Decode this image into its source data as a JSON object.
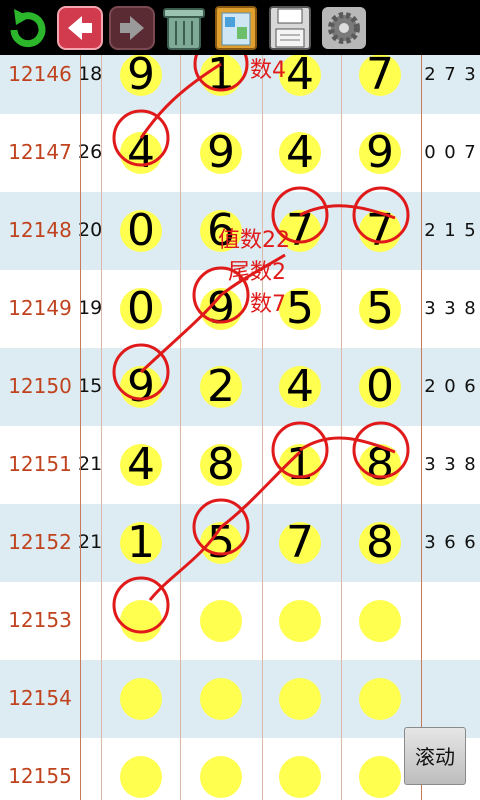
{
  "toolbar": {
    "buttons": [
      {
        "name": "refresh-icon"
      },
      {
        "name": "back-arrow-icon"
      },
      {
        "name": "forward-arrow-icon"
      },
      {
        "name": "trash-icon"
      },
      {
        "name": "clipboard-icon"
      },
      {
        "name": "save-disk-icon"
      },
      {
        "name": "gear-icon"
      }
    ]
  },
  "colors": {
    "digit_circle": "#ffff50",
    "id_text": "#c0431f",
    "annotation_red": "#e01a1a",
    "row_alt": "#dcecf2"
  },
  "rows": [
    {
      "id": "12146",
      "sum": "18",
      "digits": [
        "9",
        "1",
        "4",
        "7"
      ],
      "tail": [
        "2",
        "7",
        "3"
      ]
    },
    {
      "id": "12147",
      "sum": "26",
      "digits": [
        "4",
        "9",
        "4",
        "9"
      ],
      "tail": [
        "0",
        "0",
        "7"
      ]
    },
    {
      "id": "12148",
      "sum": "20",
      "digits": [
        "0",
        "6",
        "7",
        "7"
      ],
      "tail": [
        "2",
        "1",
        "5"
      ]
    },
    {
      "id": "12149",
      "sum": "19",
      "digits": [
        "0",
        "9",
        "5",
        "5"
      ],
      "tail": [
        "3",
        "3",
        "8"
      ]
    },
    {
      "id": "12150",
      "sum": "15",
      "digits": [
        "9",
        "2",
        "4",
        "0"
      ],
      "tail": [
        "2",
        "0",
        "6"
      ]
    },
    {
      "id": "12151",
      "sum": "21",
      "digits": [
        "4",
        "8",
        "1",
        "8"
      ],
      "tail": [
        "3",
        "3",
        "8"
      ]
    },
    {
      "id": "12152",
      "sum": "21",
      "digits": [
        "1",
        "5",
        "7",
        "8"
      ],
      "tail": [
        "3",
        "6",
        "6"
      ]
    },
    {
      "id": "12153",
      "sum": "",
      "digits": [
        "",
        "",
        "",
        ""
      ],
      "tail": [
        "",
        "",
        ""
      ]
    },
    {
      "id": "12154",
      "sum": "",
      "digits": [
        "",
        "",
        "",
        ""
      ],
      "tail": [
        "",
        "",
        ""
      ]
    },
    {
      "id": "12155",
      "sum": "",
      "digits": [
        "",
        "",
        "",
        ""
      ],
      "tail": [
        "",
        "",
        ""
      ]
    }
  ],
  "annotations": {
    "top": "数4",
    "line1": "值数22",
    "line2": "尾数2",
    "line3": "数7"
  },
  "scroll_button": {
    "label": "滚动"
  }
}
